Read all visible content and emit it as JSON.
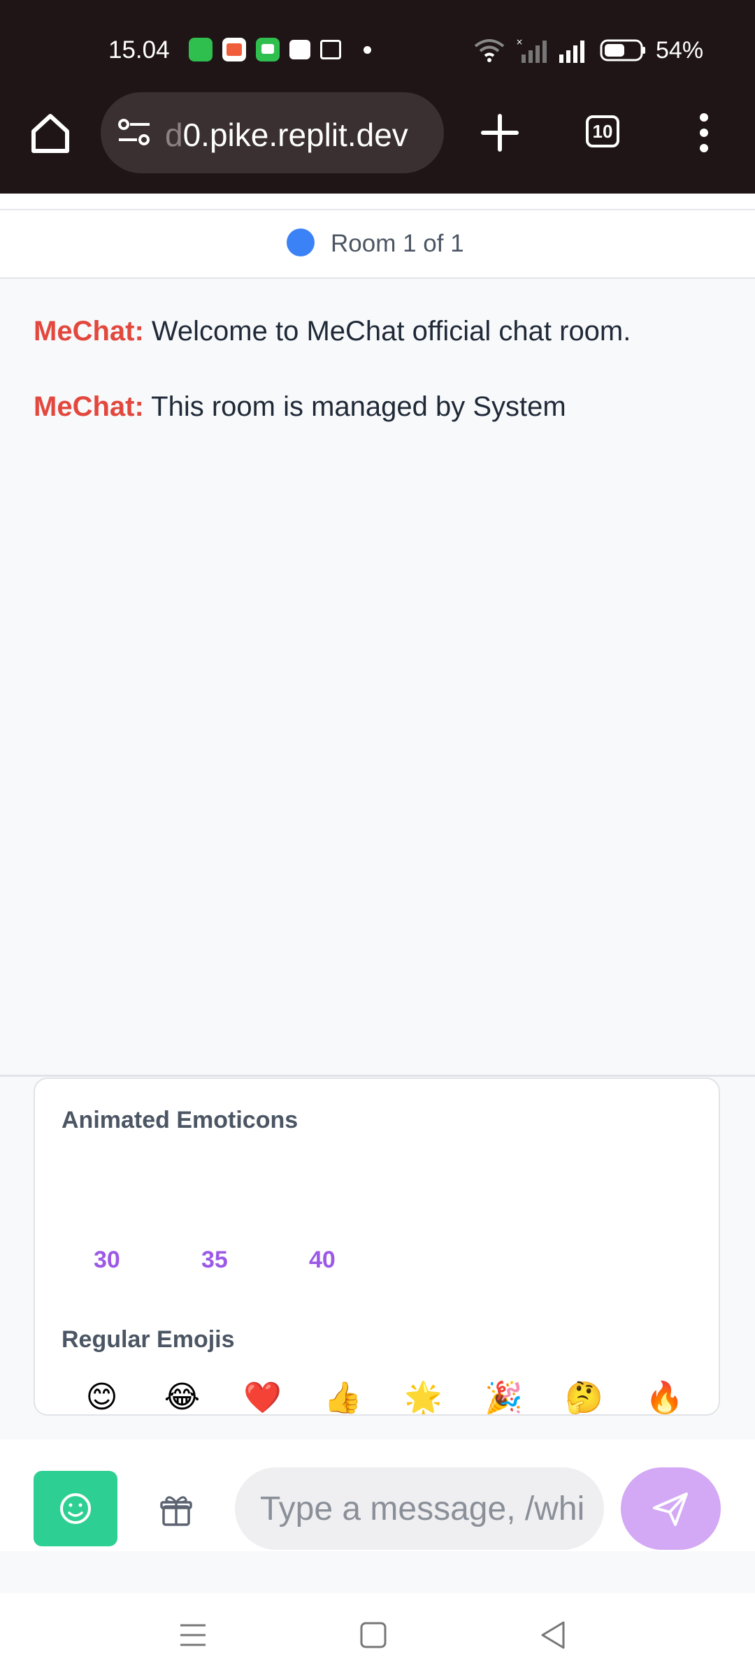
{
  "status_bar": {
    "time": "15.04",
    "battery": "54%",
    "icons": [
      "app-notification-icon",
      "app-notification-icon",
      "chat-notification-icon",
      "wallet-icon",
      "media-icon",
      "wifi-icon",
      "signal-icon",
      "signal-icon",
      "battery-icon"
    ]
  },
  "browser": {
    "url_faded": "d",
    "url": "0.pike.replit.dev",
    "tab_count": "10",
    "icons": [
      "home-icon",
      "site-settings-icon",
      "plus-icon",
      "tabs-icon",
      "more-vert-icon"
    ]
  },
  "room": {
    "label": "Room 1 of 1",
    "indicator_color": "#3b82f6"
  },
  "messages": [
    {
      "sender": "MeChat:",
      "text": " Welcome to MeChat official chat room."
    },
    {
      "sender": "MeChat:",
      "text": " This room is managed by System"
    }
  ],
  "emoji_panel": {
    "animated_heading": "Animated Emoticons",
    "animated_items": [
      "30",
      "35",
      "40"
    ],
    "regular_heading": "Regular Emojis",
    "regular_items": [
      "😊",
      "😂",
      "❤️",
      "👍",
      "🌟",
      "🎉",
      "🤔",
      "🔥"
    ]
  },
  "composer": {
    "placeholder": "Type a message, /whisper",
    "emoji_button_color": "#2ecf92",
    "send_button_color": "#d3a8f5",
    "icons": [
      "smile-icon",
      "gift-icon",
      "send-icon"
    ]
  },
  "nav_bar": {
    "icons": [
      "menu-icon",
      "home-square-icon",
      "back-icon"
    ]
  }
}
